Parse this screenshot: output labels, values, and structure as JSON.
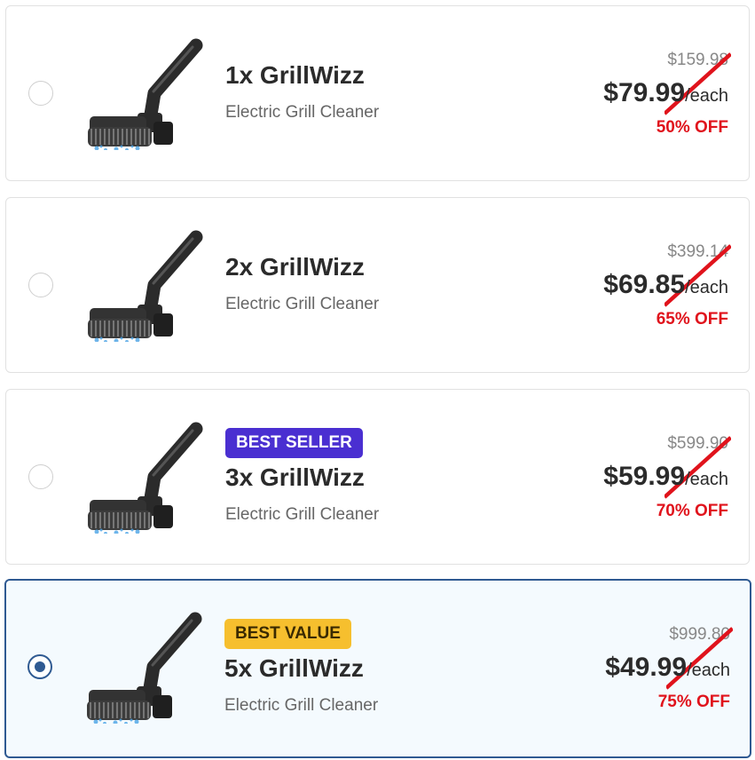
{
  "offers": [
    {
      "badge": "",
      "name": "1x GrillWizz",
      "subtitle": "Electric Grill Cleaner",
      "old_price": "$159.98",
      "price": "$79.99",
      "unit": "/each",
      "discount": "50% OFF",
      "selected": false
    },
    {
      "badge": "",
      "name": "2x GrillWizz",
      "subtitle": "Electric Grill Cleaner",
      "old_price": "$399.14",
      "price": "$69.85",
      "unit": "/each",
      "discount": "65% OFF",
      "selected": false
    },
    {
      "badge": "BEST SELLER",
      "name": "3x GrillWizz",
      "subtitle": "Electric Grill Cleaner",
      "old_price": "$599.90",
      "price": "$59.99",
      "unit": "/each",
      "discount": "70% OFF",
      "selected": false
    },
    {
      "badge": "BEST VALUE",
      "name": "5x GrillWizz",
      "subtitle": "Electric Grill Cleaner",
      "old_price": "$999.80",
      "price": "$49.99",
      "unit": "/each",
      "discount": "75% OFF",
      "selected": true
    }
  ],
  "colors": {
    "selected_border": "#2f5a92",
    "selected_background": "#f4fafe",
    "discount_red": "#e0131c",
    "best_seller_badge": "#4a2fd1",
    "best_value_badge": "#f6bf2e"
  },
  "icons": {
    "product_image": "electric-grill-cleaner-brush"
  }
}
